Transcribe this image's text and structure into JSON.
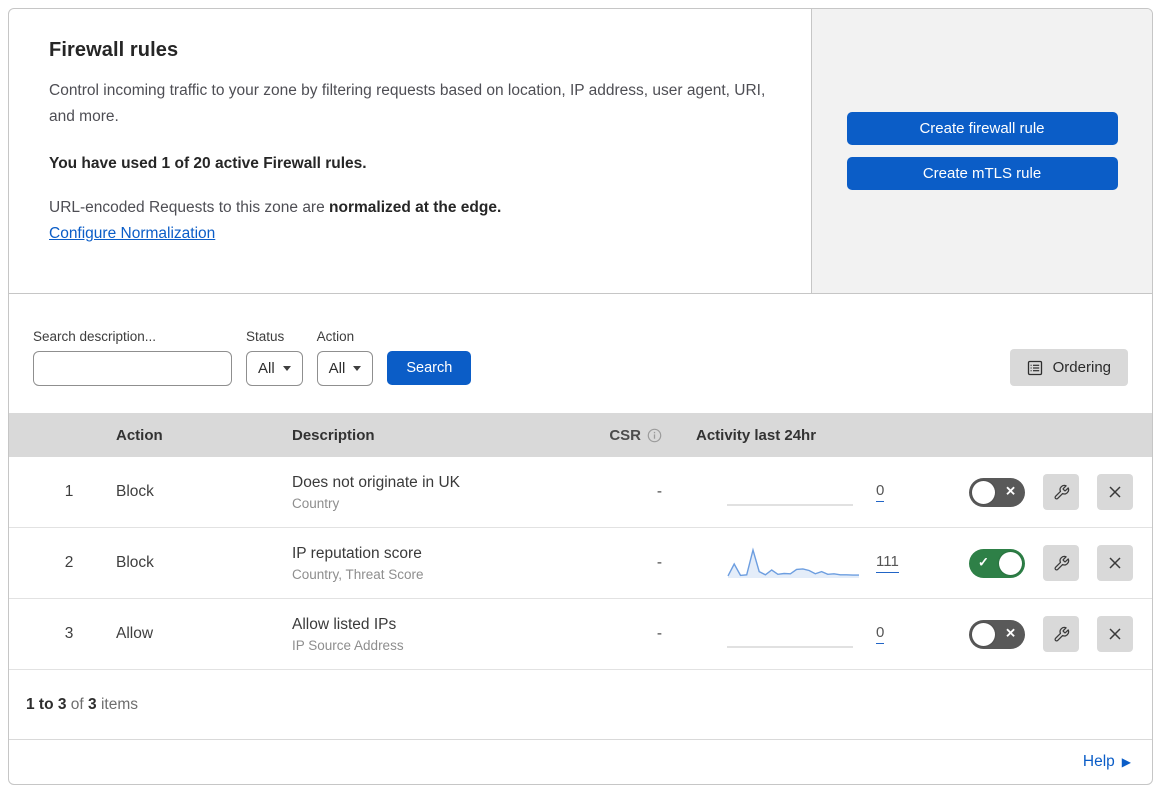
{
  "colors": {
    "accent_blue": "#0b5dc7",
    "toggle_on_green": "#2e8047",
    "toggle_off_gray": "#595959",
    "table_header_gray": "#d9d9d9",
    "panel_gray": "#f2f2f2",
    "spark_line_blue": "#6d9ee0",
    "spark_fill_blue": "#e4edf9",
    "spark_zero_gray": "#cfcfcf"
  },
  "icons": {
    "search": "magnifying-glass",
    "dropdown": "caret-down-triangle",
    "ordering": "list-box",
    "csr_info": "info-circle",
    "toggle_on": "check",
    "toggle_off": "cross",
    "edit": "wrench",
    "delete": "x",
    "help": "triangle-right"
  },
  "header": {
    "title": "Firewall rules",
    "description": "Control incoming traffic to your zone by filtering requests based on location, IP address, user agent, URI, and more.",
    "usage_note": "You have used 1 of 20 active Firewall rules.",
    "normalization_text": "URL-encoded Requests to this zone are ",
    "normalization_bold": "normalized at the edge.",
    "normalization_link": "Configure Normalization",
    "create_firewall_rule_button": "Create firewall rule",
    "create_mtls_rule_button": "Create mTLS rule"
  },
  "filters": {
    "search_label": "Search description...",
    "search_value": "",
    "status_label": "Status",
    "status_value": "All",
    "action_label": "Action",
    "action_value": "All",
    "search_button": "Search",
    "ordering_button": "Ordering"
  },
  "table": {
    "columns": {
      "action": "Action",
      "description": "Description",
      "csr": "CSR",
      "activity": "Activity last 24hr"
    },
    "rows": [
      {
        "index": "1",
        "action": "Block",
        "description": "Does not originate in UK",
        "fields": "Country",
        "csr": "-",
        "activity_count": "0",
        "enabled": false,
        "spark": [
          0
        ]
      },
      {
        "index": "2",
        "action": "Block",
        "description": "IP reputation score",
        "fields": "Country, Threat Score",
        "csr": "-",
        "activity_count": "111",
        "enabled": true,
        "spark": [
          4,
          48,
          6,
          8,
          100,
          20,
          8,
          26,
          10,
          13,
          12,
          28,
          30,
          24,
          12,
          20,
          10,
          12,
          8,
          8,
          7,
          7
        ]
      },
      {
        "index": "3",
        "action": "Allow",
        "description": "Allow listed IPs",
        "fields": "IP Source Address",
        "csr": "-",
        "activity_count": "0",
        "enabled": false,
        "spark": [
          0
        ]
      }
    ]
  },
  "footer": {
    "range": "1 to 3",
    "of_text": " of ",
    "total": "3",
    "items_text": " items",
    "help_label": "Help"
  }
}
